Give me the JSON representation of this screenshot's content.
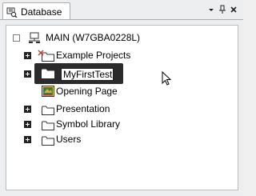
{
  "panel": {
    "tab_label": "Database",
    "tab_icon": "database-icon",
    "buttons": [
      {
        "name": "dropdown-arrow-icon",
        "glyph": "▾"
      },
      {
        "name": "pin-icon",
        "glyph": "📌"
      },
      {
        "name": "close-icon",
        "glyph": "✕"
      }
    ]
  },
  "tree": {
    "root": {
      "label": "MAIN (W7GBA0228L)",
      "icon": "computer-icon",
      "expander": "minus"
    },
    "items": [
      {
        "label": "Example Projects",
        "icon": "folder-icon",
        "expander": "plus",
        "badge": "red-x-icon"
      },
      {
        "label": "MyFirstTest",
        "icon": "folder-icon",
        "expander": "plus",
        "editing": true
      },
      {
        "label": "Opening Page",
        "icon": "page-icon",
        "expander": "none"
      },
      {
        "label": "Presentation",
        "icon": "folder-icon",
        "expander": "plus"
      },
      {
        "label": "Symbol Library",
        "icon": "folder-icon",
        "expander": "plus"
      },
      {
        "label": "Users",
        "icon": "folder-icon",
        "expander": "plus"
      }
    ]
  },
  "colors": {
    "tree_bg": "#ffffff",
    "panel_bg": "#eceef0",
    "edit_frame": "#2b2b2b",
    "badge_red": "#c0392b"
  }
}
